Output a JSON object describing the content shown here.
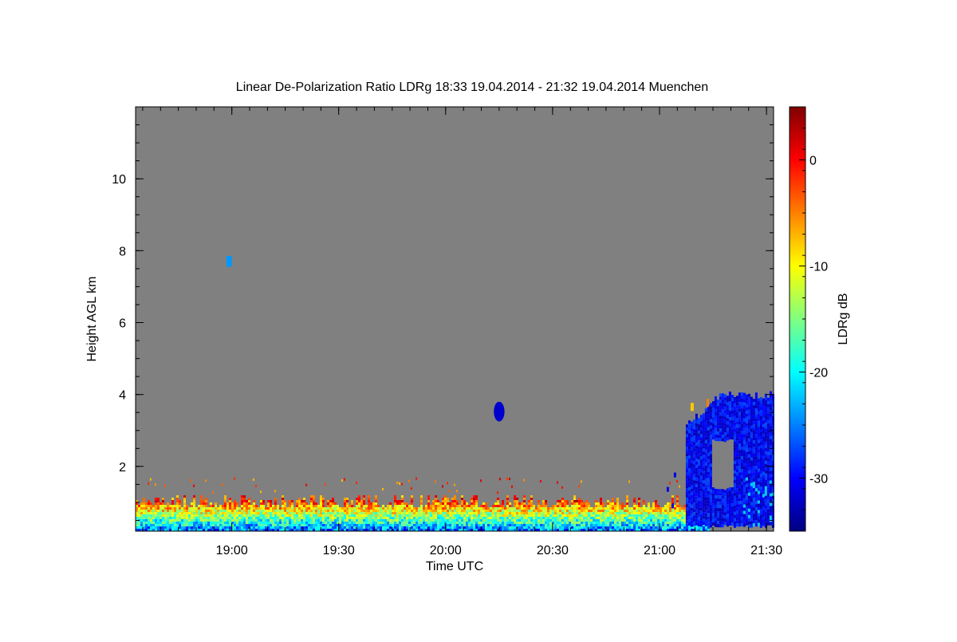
{
  "chart_data": {
    "type": "heatmap",
    "title": "Linear De-Polarization Ratio LDRg   18:33 19.04.2014 - 21:32 19.04.2014 Muenchen",
    "xlabel": "Time UTC",
    "ylabel": "Height AGL km",
    "x_ticks": [
      {
        "v": 1140,
        "label": "19:00"
      },
      {
        "v": 1170,
        "label": "19:30"
      },
      {
        "v": 1200,
        "label": "20:00"
      },
      {
        "v": 1230,
        "label": "20:30"
      },
      {
        "v": 1260,
        "label": "21:00"
      },
      {
        "v": 1290,
        "label": "21:30"
      }
    ],
    "xlim": [
      1113,
      1292
    ],
    "ylim": [
      0.2,
      12.0
    ],
    "y_ticks": [
      2,
      4,
      6,
      8,
      10
    ],
    "background_color": "#808080",
    "colorbar": {
      "label": "LDRg dB",
      "range": [
        -35,
        5
      ],
      "ticks": [
        0,
        -10,
        -20,
        -30
      ],
      "colormap": [
        "#00007f",
        "#0000ff",
        "#0080ff",
        "#00ffff",
        "#80ff80",
        "#ffff00",
        "#ff8000",
        "#ff0000",
        "#7f0000"
      ]
    },
    "features": [
      {
        "name": "boundary layer",
        "x": [
          1113,
          1274
        ],
        "y": [
          0.2,
          1.3
        ],
        "ldr_db": [
          -25,
          -3
        ]
      },
      {
        "name": "isolated echo",
        "x": [
          1213.5,
          1216.5
        ],
        "y": [
          3.25,
          3.8
        ],
        "ldr_db": -32
      },
      {
        "name": "echo",
        "x": [
          1138.5,
          1140.0
        ],
        "y": [
          7.55,
          7.85
        ],
        "ldr_db": -24
      },
      {
        "name": "cloud/precipitation",
        "x": [
          1262,
          1292
        ],
        "y": [
          0.2,
          4.1
        ],
        "ldr_db": -30
      }
    ]
  }
}
